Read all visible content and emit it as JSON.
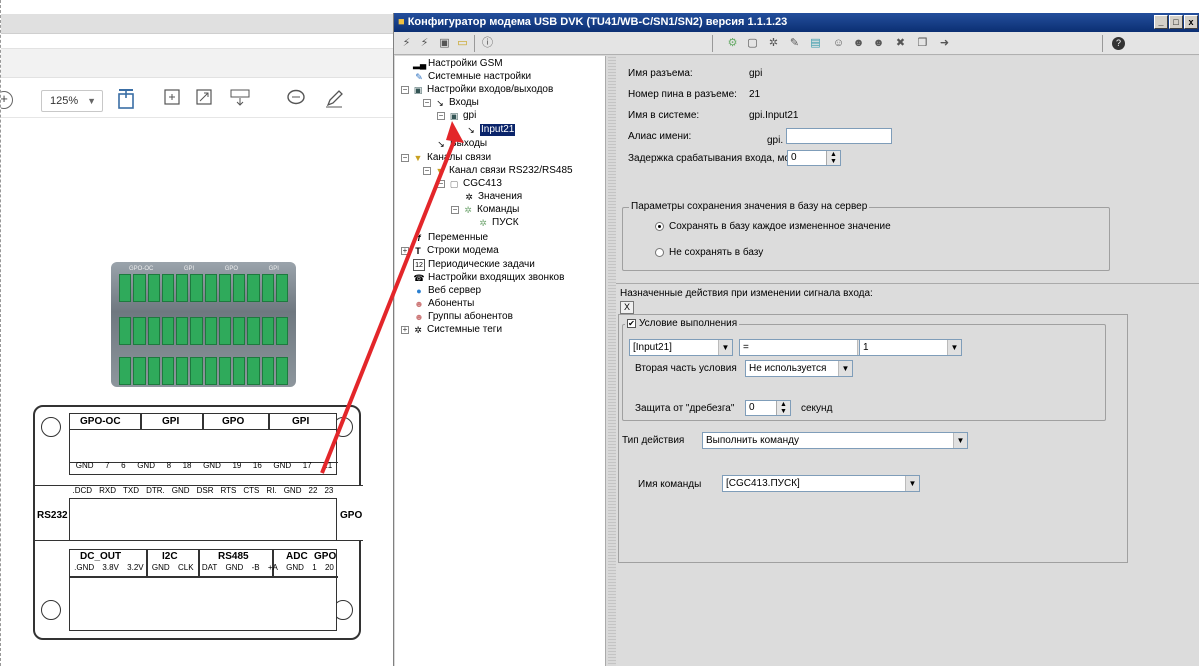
{
  "left_viewer": {
    "zoom": "125%"
  },
  "device": {
    "labels": [
      "GPO-OC",
      "GPI",
      "GPO",
      "GPI"
    ]
  },
  "diagram": {
    "top_headers": [
      "GPO-OC",
      "GPI",
      "GPO",
      "GPI"
    ],
    "top_pins": [
      "GND",
      "7",
      "6",
      "GND",
      "8",
      "18",
      "GND",
      "19",
      "16",
      "GND",
      "17",
      "21"
    ],
    "mid_pins": [
      ".DCD",
      "RXD",
      "TXD",
      "DTR.",
      "GND",
      "DSR",
      "RTS",
      "CTS",
      "RI.",
      "GND",
      "22",
      "23"
    ],
    "rs232": "RS232",
    "gpo": "GPO",
    "bottom_headers": [
      "DC_OUT",
      "I2C",
      "RS485",
      "ADC",
      "GPO"
    ],
    "bottom_pins": [
      ".GND",
      "3.8V",
      "3.2V",
      "GND",
      "CLK",
      "DAT",
      "GND",
      "-B",
      "+A",
      "GND",
      "1",
      "20"
    ]
  },
  "window": {
    "title": "Конфигуратор модема USB DVK (TU41/WB-C/SN1/SN2)  версия 1.1.1.23",
    "btn_min": "_",
    "btn_max": "□",
    "btn_close": "x"
  },
  "tree": {
    "items": [
      "Настройки GSM",
      "Системные настройки",
      "Настройки входов/выходов",
      "Входы",
      "gpi",
      "Input21",
      "Выходы",
      "Каналы связи",
      "Канал связи RS232/RS485",
      "CGC413",
      "Значения",
      "Команды",
      "ПУСК",
      "Переменные",
      "Строки модема",
      "Периодические задачи",
      "Настройки входящих звонков",
      "Веб сервер",
      "Абоненты",
      "Группы абонентов",
      "Системные теги"
    ]
  },
  "form": {
    "connector_label": "Имя разъема:",
    "connector_value": "gpi",
    "pin_label": "Номер пина в разъеме:",
    "pin_value": "21",
    "sysname_label": "Имя в системе:",
    "sysname_value": "gpi.Input21",
    "alias_label": "Алиас имени:",
    "alias_prefix": "gpi.",
    "alias_value": "",
    "delay_label": "Задержка срабатывания входа, мс:",
    "delay_value": "0",
    "save_group_title": "Параметры сохранения значения в базу на сервер",
    "radio_save_each": "Сохранять в базу каждое измененное значение",
    "radio_no_save": "Не сохранять в базу",
    "actions_title": "Назначенные действия при изменении сигнала входа:",
    "x_button": "X",
    "condition_title": "Условие выполнения",
    "cond_left": "[Input21]",
    "cond_op": "=",
    "cond_right": "1",
    "second_part_label": "Вторая часть условия",
    "second_part_value": "Не используется",
    "debounce_label": "Защита от \"дребезга\"",
    "debounce_value": "0",
    "debounce_unit": "секунд",
    "action_type_label": "Тип действия",
    "action_type_value": "Выполнить команду",
    "command_label": "Имя команды",
    "command_value": "[CGC413.ПУСК]"
  }
}
